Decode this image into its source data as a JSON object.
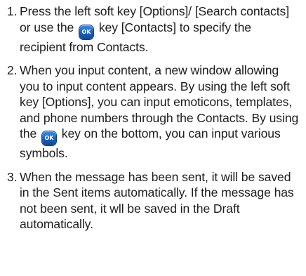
{
  "steps": [
    {
      "number": "1.",
      "text_before_icon": "Press the left soft key [Options]/ [Search contacts] or use the",
      "icon_label": "OK",
      "text_after_icon": "key [Contacts] to specify the recipient from Contacts."
    },
    {
      "number": "2.",
      "text_before_icon": "When you input content, a new window allowing you to input content appears. By using the left soft key [Options], you can input emoticons, templates, and phone numbers through the Contacts. By using the",
      "icon_label": "OK",
      "text_after_icon": "key on the bottom, you can input various symbols."
    },
    {
      "number": "3.",
      "text": "When the message has been sent, it will be saved in the Sent items automatically. If the message has not been sent, it wll be saved in the Draft automatically."
    }
  ],
  "colors": {
    "text": "#1e1e1e",
    "ok_key": "#1a5fb8"
  },
  "icons": [
    "ok-key-icon"
  ]
}
